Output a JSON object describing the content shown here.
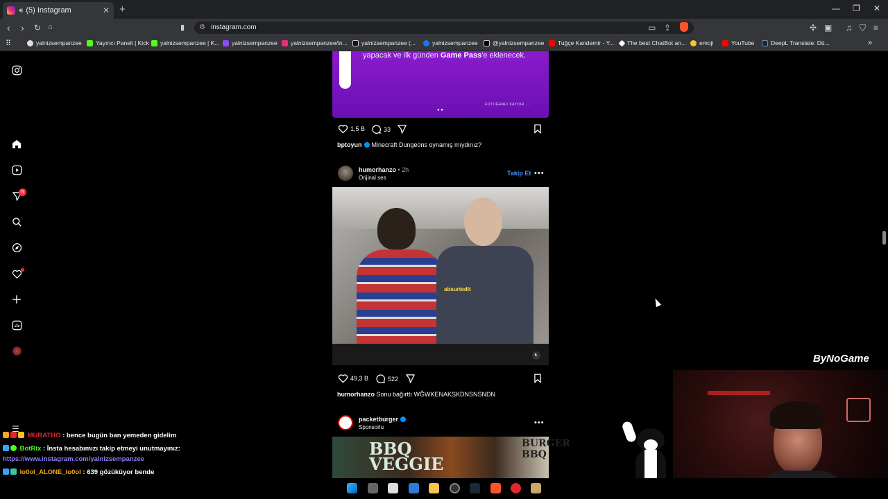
{
  "browser": {
    "tab_title": "(5) Instagram",
    "tab_close": "✕",
    "new_tab": "+",
    "url": "instagram.com",
    "bookmarks": [
      {
        "label": "yalnizsempanzee",
        "color": "#ffffff"
      },
      {
        "label": "Yayıncı Paneli | Kick",
        "color": "#53fc18"
      },
      {
        "label": "yalnizsempanzee | K...",
        "color": "#53fc18"
      },
      {
        "label": "yalnizsempanzee",
        "color": "#9146ff"
      },
      {
        "label": "yalnizsempanzee/in...",
        "color": "#ee2a7b"
      },
      {
        "label": "yalnizsempanzee (...",
        "color": "#ffffff"
      },
      {
        "label": "yalnizsempanzee",
        "color": "#1877f2"
      },
      {
        "label": "@yalnizsempanzee",
        "color": "#ffffff"
      },
      {
        "label": "Tuğçe Kandemir - Y...",
        "color": "#ff0000"
      },
      {
        "label": "The best ChatBot an...",
        "color": "#ffffff"
      },
      {
        "label": "emoji",
        "color": "#f4c430"
      },
      {
        "label": "YouTube",
        "color": "#ff0000"
      },
      {
        "label": "DeepL Translate: Dü...",
        "color": "#0f2b46"
      }
    ],
    "bookmarks_more": "»"
  },
  "nav": {
    "notifications_count": "5"
  },
  "post1": {
    "promo_line": "yapacak ve ilk günden ",
    "promo_bold": "Game Pass",
    "promo_tail": "'e eklenecek.",
    "photo_link": "FOTOĞRAFI KAYDIR →",
    "likes": "1,5 B",
    "comments": "33",
    "caption_user": "bptoyun",
    "caption_text": "Minecraft Dungeons oynamış mıydınız?"
  },
  "post2": {
    "username": "humorhanzo",
    "time": " • 2h",
    "audio": "Orijinal ses",
    "follow_label": "Takip Et",
    "more": "•••",
    "watermark": "absurtedit",
    "likes": "49,3 B",
    "comments": "522",
    "caption_user": "humorhanzo",
    "caption_text": "Sonu bağırttı WĞWKENAKSKDNSNSNDN"
  },
  "post3": {
    "username": "packetburger",
    "sponsored": "Sponsorlu",
    "more": "•••",
    "image_text_left": "BBQ\nVEGGIE",
    "image_text_right": "BURGER\nBBQ"
  },
  "chat": [
    {
      "user": "MURATHO",
      "color": "#e0262f",
      "message": " : bence bugün ban yemeden gidelim"
    },
    {
      "user": "BotRix",
      "color": "#53fc18",
      "message": " : İnsta hesabımızı takip etmeyi unutmayınız:"
    },
    {
      "user": "lo0ol_ALONE_lo0ol",
      "color": "#f5a623",
      "message": " : 639 gözüküyor bende"
    }
  ],
  "chat_link": "https://www.instagram.com/yalnizsempanzee",
  "stream_logo": "ByNoGame",
  "colors": {
    "accent": "#0095f6",
    "follow": "#4f8cf7",
    "badge": "#ff3040"
  }
}
